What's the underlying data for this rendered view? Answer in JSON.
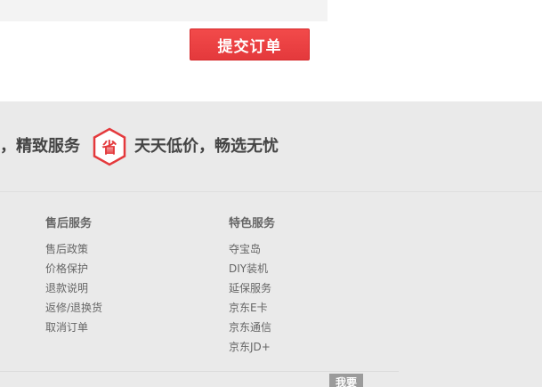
{
  "order": {
    "submit_label": "提交订单"
  },
  "footer": {
    "slogan_left": "，精致服务",
    "badge_char": "省",
    "slogan_right": "天天低价，畅选无忧",
    "columns": [
      {
        "title": "售后服务",
        "links": [
          "售后政策",
          "价格保护",
          "退款说明",
          "返修/退换货",
          "取消订单"
        ]
      },
      {
        "title": "特色服务",
        "links": [
          "夺宝岛",
          "DIY装机",
          "延保服务",
          "京东E卡",
          "京东通信",
          "京东JD+"
        ]
      }
    ],
    "feedback_label": "我要"
  },
  "colors": {
    "accent": "#e4393c",
    "footer_bg": "#eaeaea",
    "text": "#666666"
  }
}
